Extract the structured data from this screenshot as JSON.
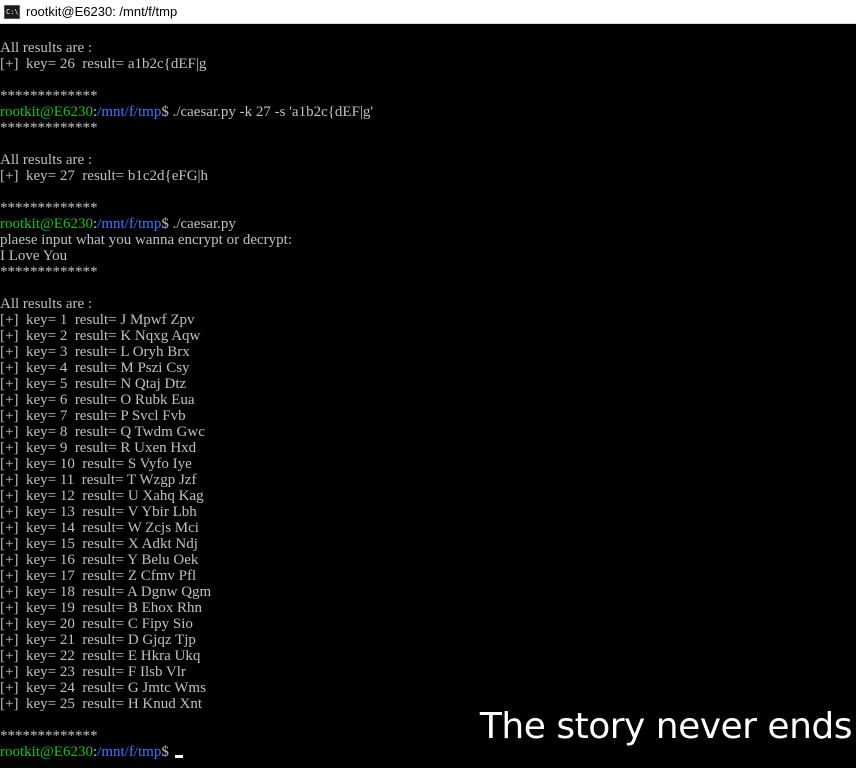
{
  "window": {
    "title": "rootkit@E6230: /mnt/f/tmp",
    "icon": "console-icon",
    "icon_glyph": "C:\\"
  },
  "prompt": {
    "user_host": "rootkit@E6230",
    "sep": ":",
    "path": "/mnt/f/tmp",
    "symbol": "$ "
  },
  "lines": [
    "All results are :",
    "[+]  key= 26  result= a1b2c{dEF|g",
    "",
    "*************",
    "PROMPT|./caesar.py -k 27 -s 'a1b2c{dEF|g'",
    "*************",
    "",
    "All results are :",
    "[+]  key= 27  result= b1c2d{eFG|h",
    "",
    "*************",
    "PROMPT|./caesar.py",
    "plaese input what you wanna encrypt or decrypt:",
    "I Love You",
    "*************",
    "",
    "All results are :",
    "[+]  key= 1  result= J Mpwf Zpv",
    "[+]  key= 2  result= K Nqxg Aqw",
    "[+]  key= 3  result= L Oryh Brx",
    "[+]  key= 4  result= M Pszi Csy",
    "[+]  key= 5  result= N Qtaj Dtz",
    "[+]  key= 6  result= O Rubk Eua",
    "[+]  key= 7  result= P Svcl Fvb",
    "[+]  key= 8  result= Q Twdm Gwc",
    "[+]  key= 9  result= R Uxen Hxd",
    "[+]  key= 10  result= S Vyfo Iye",
    "[+]  key= 11  result= T Wzgp Jzf",
    "[+]  key= 12  result= U Xahq Kag",
    "[+]  key= 13  result= V Ybir Lbh",
    "[+]  key= 14  result= W Zcjs Mci",
    "[+]  key= 15  result= X Adkt Ndj",
    "[+]  key= 16  result= Y Belu Oek",
    "[+]  key= 17  result= Z Cfmv Pfl",
    "[+]  key= 18  result= A Dgnw Qgm",
    "[+]  key= 19  result= B Ehox Rhn",
    "[+]  key= 20  result= C Fipy Sio",
    "[+]  key= 21  result= D Gjqz Tjp",
    "[+]  key= 22  result= E Hkra Ukq",
    "[+]  key= 23  result= F Ilsb Vlr",
    "[+]  key= 24  result= G Jmtc Wms",
    "[+]  key= 25  result= H Knud Xnt",
    "",
    "*************",
    "PROMPT|"
  ],
  "overlay_text": "The story never ends",
  "colors": {
    "background": "#000000",
    "text": "#c0c0c0",
    "user_host": "#13c313",
    "path": "#3b78ff",
    "cursor": "#ffffff"
  }
}
